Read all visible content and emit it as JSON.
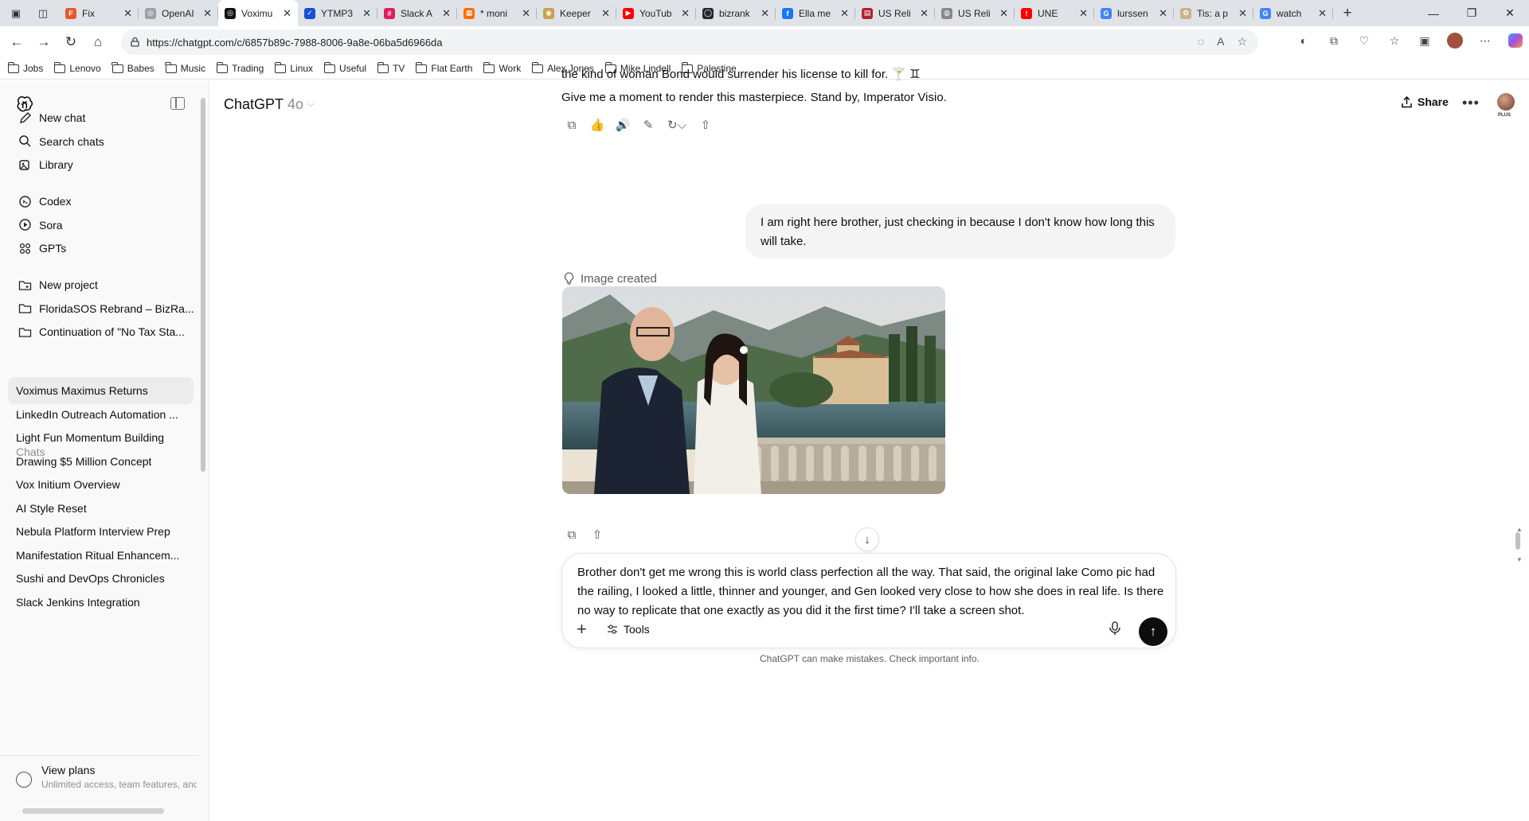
{
  "browser": {
    "tabs": [
      {
        "label": "Fix",
        "color": "#e8572b",
        "glyph": "F"
      },
      {
        "label": "OpenAI",
        "color": "#9aa0a6",
        "glyph": "◎"
      },
      {
        "label": "Voximu",
        "color": "#111111",
        "glyph": "◎",
        "active": true
      },
      {
        "label": "YTMP3",
        "color": "#1a4fd8",
        "glyph": "✓"
      },
      {
        "label": "Slack A",
        "color": "#e01e5a",
        "glyph": "#"
      },
      {
        "label": "* moni",
        "color": "#ff6d00",
        "glyph": "▦"
      },
      {
        "label": "Keeper",
        "color": "#c9a14a",
        "glyph": "◉"
      },
      {
        "label": "YouTub",
        "color": "#ff0000",
        "glyph": "▶"
      },
      {
        "label": "bizrank",
        "color": "#24292e",
        "glyph": "◯"
      },
      {
        "label": "Ella me",
        "color": "#1877f2",
        "glyph": "f"
      },
      {
        "label": "US Reli",
        "color": "#b22234",
        "glyph": "▤"
      },
      {
        "label": "US Reli",
        "color": "#888888",
        "glyph": "◍"
      },
      {
        "label": "UNE",
        "color": "#ff0000",
        "glyph": "!"
      },
      {
        "label": "lurssen",
        "color": "#4285f4",
        "glyph": "G"
      },
      {
        "label": "Tis: a p",
        "color": "#c9b28a",
        "glyph": "✿"
      },
      {
        "label": "watch",
        "color": "#4285f4",
        "glyph": "G"
      }
    ],
    "url": "https://chatgpt.com/c/6857b89c-7988-8006-9a8e-06ba5d6966da",
    "bookmarks": [
      "Jobs",
      "Lenovo",
      "Babes",
      "Music",
      "Trading",
      "Linux",
      "Useful",
      "TV",
      "Flat Earth",
      "Work",
      "Alex Jones",
      "Mike Lindell",
      "Palestine"
    ]
  },
  "sidebar": {
    "top_items": [
      {
        "label": "New chat",
        "icon": "edit-icon"
      },
      {
        "label": "Search chats",
        "icon": "search-icon"
      },
      {
        "label": "Library",
        "icon": "library-icon"
      }
    ],
    "apps": [
      {
        "label": "Codex",
        "icon": "codex-icon"
      },
      {
        "label": "Sora",
        "icon": "sora-icon"
      },
      {
        "label": "GPTs",
        "icon": "gpts-icon"
      }
    ],
    "projects": [
      {
        "label": "New project",
        "icon": "folder-plus-icon"
      },
      {
        "label": "FloridaSOS Rebrand – BizRa...",
        "icon": "folder-icon"
      },
      {
        "label": "Continuation of \"No Tax Sta...",
        "icon": "folder-icon"
      }
    ],
    "chats_heading": "Chats",
    "chats": [
      "Voximus Maximus Returns",
      "LinkedIn Outreach Automation ...",
      "Light Fun Momentum Building",
      "Drawing $5 Million Concept",
      "Vox Initium Overview",
      "AI Style Reset",
      "Nebula Platform Interview Prep",
      "Manifestation Ritual Enhancem...",
      "Sushi and DevOps Chronicles",
      "Slack Jenkins Integration"
    ],
    "plans": {
      "title": "View plans",
      "subtitle": "Unlimited access, team features, and"
    }
  },
  "header": {
    "model_name": "ChatGPT",
    "model_version": "4o",
    "share_label": "Share",
    "plan_badge": "PLUS"
  },
  "conversation": {
    "assistant_line_1": "the kind of woman Bond would surrender his license to kill for. 🍸 ♊",
    "assistant_line_2": "Give me a moment to render this masterpiece. Stand by, Imperator Visio.",
    "user_message": "I am right here brother, just checking in because I don't know how long this will take.",
    "image_status": "Image created"
  },
  "composer": {
    "text": "Brother don't get me wrong this is world class perfection all the way. That said, the original lake Como pic had the railing, I looked a little, thinner and younger, and Gen looked very close to how she does in real life. Is there no way to replicate that one exactly as you did it the first time? I'll take a screen shot.",
    "tools_label": "Tools"
  },
  "footer": {
    "disclaimer": "ChatGPT can make mistakes. Check important info."
  }
}
